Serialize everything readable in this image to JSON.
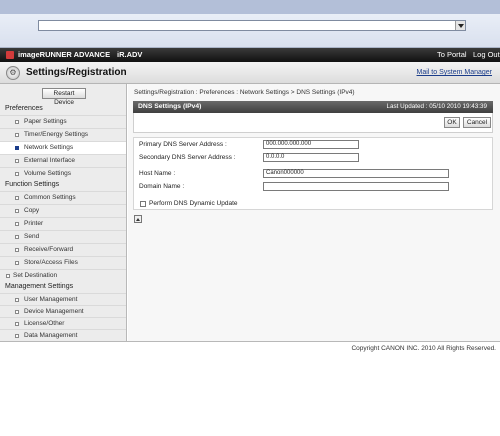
{
  "browser": {
    "address_value": ""
  },
  "header": {
    "brand": "imageRUNNER ADVANCE",
    "model": "iR.ADV",
    "to_portal": "To Portal",
    "log_out": "Log Out"
  },
  "title_bar": {
    "title": "Settings/Registration",
    "mail_link": "Mail to System Manager"
  },
  "sidebar": {
    "restart_label": "Restart Device",
    "sections": [
      {
        "title": "Preferences",
        "items": [
          "Paper Settings",
          "Timer/Energy Settings",
          "Network Settings",
          "External Interface",
          "Volume Settings"
        ]
      },
      {
        "title": "Function Settings",
        "items": [
          "Common Settings",
          "Copy",
          "Printer",
          "Send",
          "Receive/Forward",
          "Store/Access Files"
        ]
      },
      {
        "title": "",
        "items": [
          "Set Destination"
        ]
      },
      {
        "title": "Management Settings",
        "items": [
          "User Management",
          "Device Management",
          "License/Other",
          "Data Management"
        ]
      }
    ],
    "active_item": "Network Settings"
  },
  "main": {
    "breadcrumb": "Settings/Registration : Preferences : Network Settings > DNS Settings (IPv4)",
    "panel_title": "DNS Settings (IPv4)",
    "last_updated": "Last Updated : 05/10 2010 19:43:39",
    "ok_label": "OK",
    "cancel_label": "Cancel",
    "fields": {
      "primary_dns": {
        "label": "Primary DNS Server Address :",
        "value": "000.000.000.000"
      },
      "secondary_dns": {
        "label": "Secondary DNS Server Address :",
        "value": "0.0.0.0"
      },
      "host_name": {
        "label": "Host Name :",
        "value": "Canon000000"
      },
      "domain_name": {
        "label": "Domain Name :",
        "value": ""
      }
    },
    "dynamic_update_label": "Perform DNS Dynamic Update",
    "dynamic_update_checked": false
  },
  "footer": {
    "copyright": "Copyright CANON INC. 2010 All Rights Reserved."
  }
}
